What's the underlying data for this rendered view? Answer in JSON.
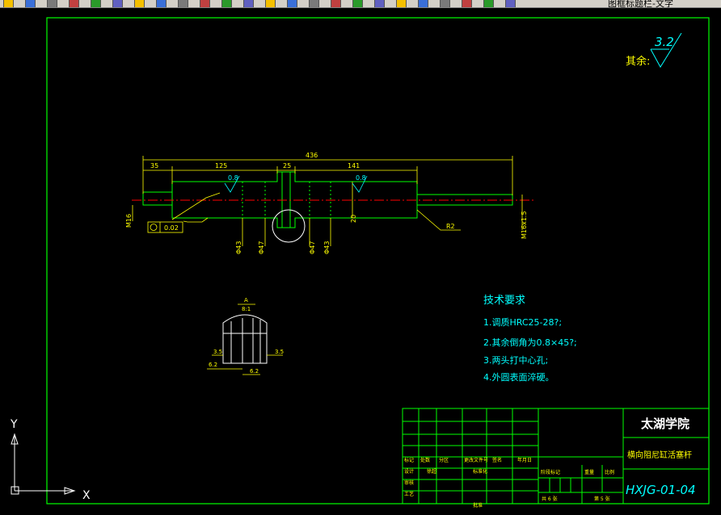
{
  "toolbar": {
    "layer_text": "图框标题栏-文字",
    "icons": [
      "open-icon",
      "save-icon",
      "print-icon",
      "preview-icon",
      "plot-icon",
      "cut-icon",
      "copy-icon",
      "paste-icon",
      "match-icon",
      "brush-icon",
      "undo-icon",
      "redo-icon",
      "pan-icon",
      "zoom-realtime-icon",
      "zoom-window-icon",
      "zoom-previous-icon",
      "properties-icon",
      "designcenter-icon",
      "toolpalette-icon",
      "markup-icon",
      "calculator-icon",
      "help-icon",
      "layers-icon",
      "layer-state-icon"
    ]
  },
  "drawing": {
    "roughness_label": "其余:",
    "roughness_value": "3.2",
    "dimensions": {
      "overall": "436",
      "left_step": "35",
      "mid_left": "125",
      "groove": "25",
      "right": "141",
      "rough_left": "0.8",
      "rough_right": "0.8",
      "dia_left": "M16",
      "dia_right": "M16x1.5",
      "tolerance": "0.02",
      "chamfer": "R2",
      "dia1": "Φ43",
      "dia2": "Φ47",
      "dia3": "Φ47",
      "dia4": "Φ43",
      "width_20": "20"
    },
    "section": {
      "label_top": "A",
      "label_bottom": "8:1",
      "dim_a": "3.5",
      "dim_b": "3.5",
      "dim_c": "6.2",
      "dim_d": "6.2"
    },
    "tech_req": {
      "title": "技术要求",
      "items": [
        "1.调质HRC25-28?;",
        "2.其余倒角为0.8×45?;",
        "3.两头打中心孔;",
        "4.外圆表面淬硬。"
      ]
    }
  },
  "title_block": {
    "school": "太湖学院",
    "part_name": "横向阻尼缸活塞杆",
    "drawing_no": "HXJG-01-04",
    "row_labels": [
      "标记",
      "处数",
      "分区",
      "更改文件号",
      "签名",
      "年月日"
    ],
    "design_label": "设计",
    "std_label": "标准化",
    "check_label": "审核",
    "process_label": "工艺",
    "approve_label": "批准",
    "stage_label": "阶段标记",
    "weight_label": "重量",
    "scale_label": "比例",
    "sheet_total": "共 6 张",
    "sheet_no": "第 5 张",
    "designer": "徐超"
  },
  "ucs": {
    "x_label": "X",
    "y_label": "Y"
  },
  "colors": {
    "frame": "#00ff00",
    "dim": "#ffff00",
    "part": "#00ff00",
    "center": "#ff0000",
    "text": "#ffffff",
    "tech": "#ffff00"
  }
}
